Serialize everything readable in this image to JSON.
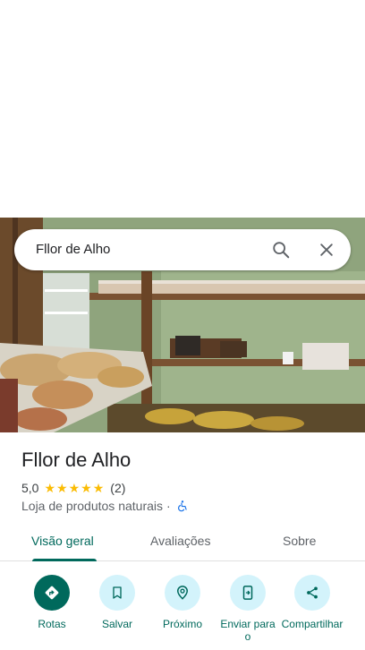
{
  "search": {
    "query": "Fllor de Alho"
  },
  "place": {
    "name": "Fllor de Alho",
    "rating": "5,0",
    "stars": 5,
    "review_count": "(2)",
    "category": "Loja de produtos naturais",
    "separator": "·"
  },
  "tabs": [
    {
      "label": "Visão geral",
      "active": true
    },
    {
      "label": "Avaliações",
      "active": false
    },
    {
      "label": "Sobre",
      "active": false
    }
  ],
  "actions": [
    {
      "label": "Rotas",
      "icon": "directions-icon"
    },
    {
      "label": "Salvar",
      "icon": "bookmark-icon"
    },
    {
      "label": "Próximo",
      "icon": "nearby-icon"
    },
    {
      "label": "Enviar para o",
      "icon": "send-to-phone-icon"
    },
    {
      "label": "Compartilhar",
      "icon": "share-icon"
    }
  ],
  "colors": {
    "accent": "#00695c",
    "action_bg": "#d3f3fb",
    "star": "#fbbc04"
  }
}
